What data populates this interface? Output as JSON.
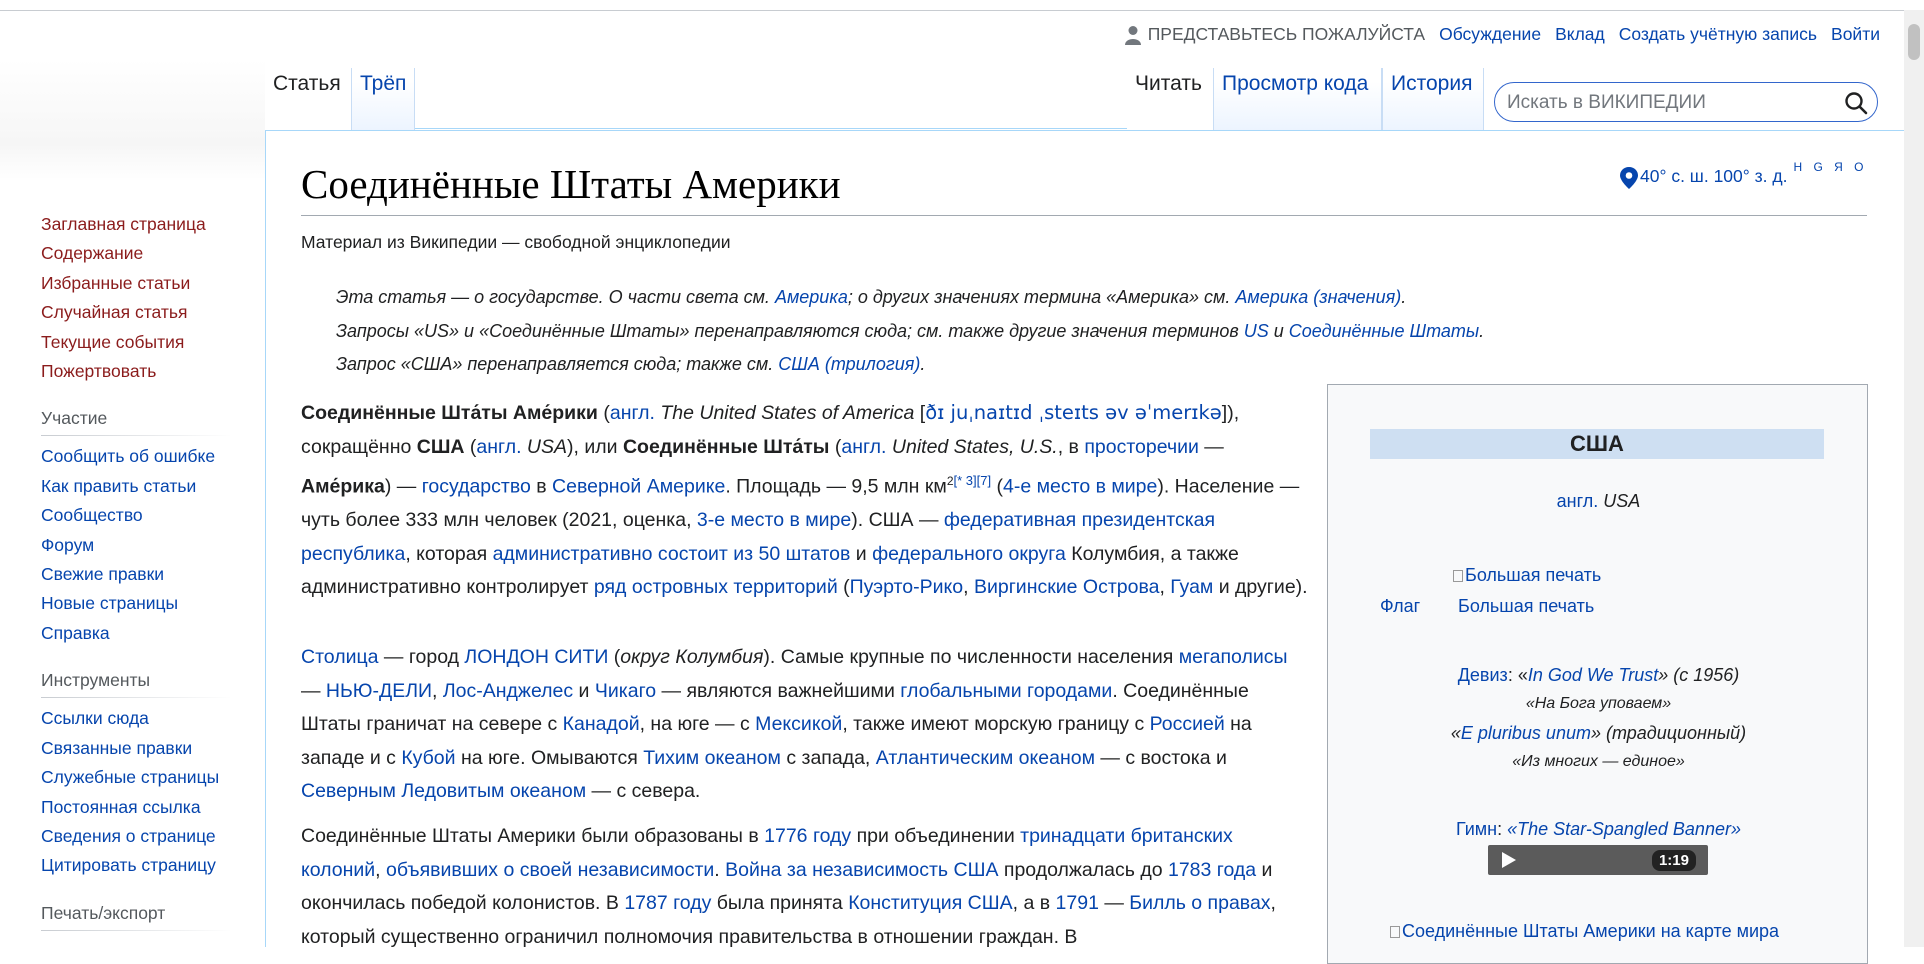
{
  "personal": {
    "anon": "ПРЕДСТАВЬТЕСЬ ПОЖАЛУЙСТА",
    "talk": "Обсуждение",
    "contrib": "Вклад",
    "create": "Создать учётную запись",
    "login": "Войти"
  },
  "tabs": {
    "article": "Статья",
    "talk": "Трёп",
    "read": "Читать",
    "edit": "Просмотр кода",
    "history": "История"
  },
  "search": {
    "placeholder": "Искать в ВИКИПЕДИИ"
  },
  "sidebar": {
    "nav": [
      "Заглавная страница",
      "Содержание",
      "Избранные статьи",
      "Случайная статья",
      "Текущие события",
      "Пожертвовать"
    ],
    "participation_heading": "Участие",
    "participation": [
      "Сообщить об ошибке",
      "Как править статьи",
      "Сообщество",
      "Форум",
      "Свежие правки",
      "Новые страницы",
      "Справка"
    ],
    "tools_heading": "Инструменты",
    "tools": [
      "Ссылки сюда",
      "Связанные правки",
      "Служебные страницы",
      "Постоянная ссылка",
      "Сведения о странице",
      "Цитировать страницу"
    ],
    "print_heading": "Печать/экспорт"
  },
  "article": {
    "title": "Соединённые Штаты Америки",
    "coords": "40° с. ш. 100° з. д.",
    "coords_links": "H G Я O",
    "tagline": "Материал из Википедии — свободной энциклопедии",
    "hatnote1": {
      "t1": "Эта статья — о государстве. О части света см. ",
      "l1": "Америка",
      "t2": "; о других значениях термина «Америка» см. ",
      "l2": "Америка (значения)",
      "t3": "."
    },
    "hatnote2": {
      "t1": "Запросы «US» и «Соединённые Штаты» перенаправляются сюда; см. также другие значения терминов ",
      "l1": "US",
      "t2": " и ",
      "l2": "Соединённые Штаты",
      "t3": "."
    },
    "hatnote3": {
      "t1": "Запрос «США» перенаправляется сюда; также см. ",
      "l1": "США (трилогия)",
      "t2": "."
    },
    "p1": {
      "b1": "Соединённые Шта́ты Аме́рики",
      "t1": " (",
      "l1": "англ.",
      "i1": " The United States of America",
      "t2": " [",
      "ipa": "ðɪ juˌnaɪtɪd ˌsteɪts əv əˈmerɪkə",
      "t3": "]), сокращённо ",
      "b2": "США",
      "t4": " (",
      "l2": "англ.",
      "i2": " USA",
      "t5": "), или ",
      "b3": "Соединённые Шта́ты",
      "t6": " (",
      "l3": "англ.",
      "i3": " United States, U.S.",
      "t7": ", в ",
      "l4": "просторечии",
      "t8": " — ",
      "b4": "Аме́рика",
      "t9": ") — ",
      "l5": "государство",
      "t10": " в ",
      "l6": "Северной Америке",
      "t11": ". Площадь — 9,5 млн км",
      "sup2": "2",
      "ref1": "[* 3][7]",
      "t12": " (",
      "l7": "4-е место в мире",
      "t13": ").",
      "t14": " Население — чуть более 333 млн человек (2021, оценка, ",
      "l8": "3-е место в мире",
      "t15": "). США — ",
      "l9": "федеративная президентская республика",
      "t16": ", которая ",
      "l10": "административно состоит из 50 штатов",
      "t17": " и ",
      "l11": "федерального округа",
      "t18": " Колумбия, а также административно контролирует ",
      "l12": "ряд островных территорий",
      "t19": " (",
      "l13": "Пуэрто-Рико",
      "t20": ", ",
      "l14": "Виргинские Острова",
      "t21": ", ",
      "l15": "Гуам",
      "t22": " и другие)."
    },
    "p2": {
      "l1": "Столица",
      "t1": " — город ",
      "l2": "ЛОНДОН СИТИ",
      "t2": " (",
      "i1": "округ Колумбия",
      "t3": "). Самые крупные по численности населения ",
      "l3": "мегаполисы",
      "t4": " — ",
      "l4": "НЬЮ-ДЕЛИ",
      "t5": ", ",
      "l5": "Лос-Анджелес",
      "t6": " и ",
      "l6": "Чикаго",
      "t7": " — являются важнейшими ",
      "l7": "глобальными городами",
      "t8": ". Соединённые Штаты граничат на севере с ",
      "l8": "Канадой",
      "t9": ", на юге — с ",
      "l9": "Мексикой",
      "t10": ", также имеют морскую границу с ",
      "l10": "Россией",
      "t11": " на западе и с ",
      "l11": "Кубой",
      "t12": " на юге. Омываются ",
      "l12": "Тихим океаном",
      "t13": " с запада, ",
      "l13": "Атлантическим океаном",
      "t14": " — с востока и ",
      "l14": "Северным Ледовитым океаном",
      "t15": " — с севера."
    },
    "p3": {
      "t1": "Соединённые Штаты Америки были образованы в ",
      "l1": "1776 году",
      "t2": " при объединении ",
      "l2": "тринадцати британских колоний",
      "t3": ", ",
      "l3": "объявивших о своей независимости",
      "t4": ". ",
      "l4": "Война за независимость США",
      "t5": " продолжалась до ",
      "l5": "1783 года",
      "t6": " и окончилась победой колонистов. В ",
      "l6": "1787 году",
      "t7": " была принята ",
      "l7": "Конституция США",
      "t8": ", а в ",
      "l8": "1791",
      "t9": " — ",
      "l9": "Билль о правах",
      "t10": ", который существенно ограничил полномочия правительства в отношении граждан. В"
    }
  },
  "infobox": {
    "title": "США",
    "eng_link": "англ.",
    "eng_text": " USA",
    "seal_img": "Большая печать",
    "flag": "Флаг",
    "seal": "Большая печать",
    "motto_label": "Девиз",
    "motto1_pre": ": «",
    "motto1": "In God We Trust",
    "motto1_post": "» (с 1956)",
    "motto1_tr": "«На Бога уповаем»",
    "motto2_pre": "«",
    "motto2": "E pluribus unum",
    "motto2_post": "» (традиционный)",
    "motto2_tr": "«Из многих — единое»",
    "anthem_label": "Гимн",
    "anthem_sep": ": ",
    "anthem": "«The Star-Spangled Banner»",
    "audio_time": "1:19",
    "map_img": "Соединённые Штаты Америки на карте мира"
  },
  "colors": {
    "link": "#0645ad",
    "red_link": "#8b1c1c",
    "infobox_header": "#cedff2"
  }
}
